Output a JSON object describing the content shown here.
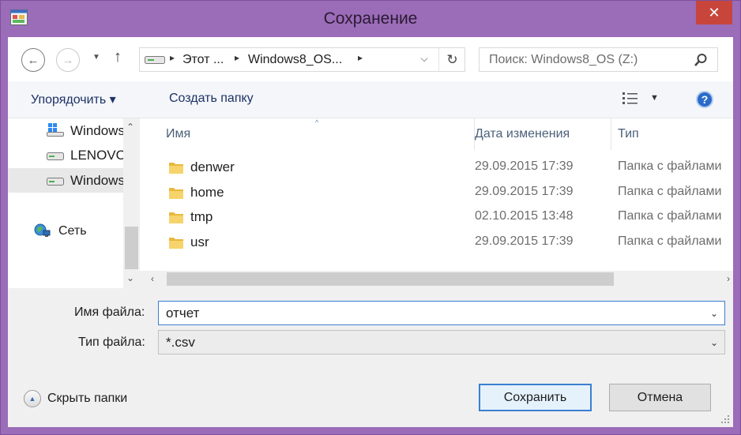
{
  "window": {
    "title": "Сохранение",
    "close_symbol": "✕"
  },
  "nav": {
    "back_symbol": "←",
    "forward_symbol": "→",
    "recent_symbol": "▼",
    "up_symbol": "↑",
    "address": {
      "parts": [
        "Этот ...",
        "Windows8_OS..."
      ],
      "separator": "▸",
      "refresh_symbol": "↻",
      "dropdown_symbol": "⌵"
    },
    "search_placeholder": "Поиск: Windows8_OS (Z:)"
  },
  "toolbar": {
    "organize_label": "Упорядочить ▾",
    "new_folder_label": "Создать папку",
    "view_drop_symbol": "▼",
    "help_symbol": "?"
  },
  "navpane": {
    "items": [
      {
        "label": "Windows",
        "icon": "windows-drive-icon"
      },
      {
        "label": "LENOVO",
        "icon": "drive-icon"
      },
      {
        "label": "Windows",
        "icon": "drive-icon",
        "selected": true
      },
      {
        "label": "Сеть",
        "icon": "network-icon"
      }
    ],
    "scroll_up": "⌃",
    "scroll_down": "⌄"
  },
  "filelist": {
    "columns": {
      "name": "Имя",
      "date": "Дата изменения",
      "type": "Тип"
    },
    "sort_arrow": "^",
    "rows": [
      {
        "name": "denwer",
        "date": "29.09.2015 17:39",
        "type": "Папка с файлами"
      },
      {
        "name": "home",
        "date": "29.09.2015 17:39",
        "type": "Папка с файлами"
      },
      {
        "name": "tmp",
        "date": "02.10.2015 13:48",
        "type": "Папка с файлами"
      },
      {
        "name": "usr",
        "date": "29.09.2015 17:39",
        "type": "Папка с файлами"
      }
    ],
    "scroll_left": "‹",
    "scroll_right": "›"
  },
  "form": {
    "filename_label": "Имя файла:",
    "filename_value": "отчет",
    "filetype_label": "Тип файла:",
    "filetype_value": "*.csv",
    "combo_caret": "⌄",
    "hide_folders_label": "Скрыть папки",
    "hide_folders_symbol": "▲",
    "save_label": "Сохранить",
    "cancel_label": "Отмена"
  },
  "colors": {
    "window_frame": "#9b6cb8",
    "close_button": "#c7453a",
    "toolbar_text": "#1e3264",
    "accent": "#3c7fd1"
  }
}
